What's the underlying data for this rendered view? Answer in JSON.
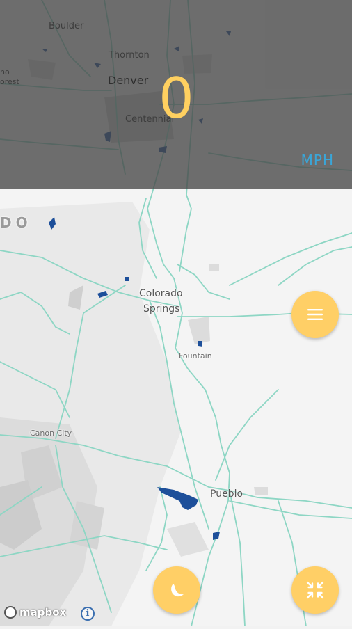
{
  "map": {
    "cities": {
      "boulder": "Boulder",
      "thornton": "Thornton",
      "denver": "Denver",
      "centennial": "Centennial",
      "colorado": "Colorado",
      "springs": "Springs",
      "fountain": "Fountain",
      "canon_city": "Canon City",
      "pueblo": "Pueblo",
      "state_fragment": "DO",
      "left_fragment_1": "no",
      "left_fragment_2": "orest"
    }
  },
  "speedometer": {
    "speed": "0",
    "unit": "MPH"
  },
  "attribution": {
    "brand": "mapbox",
    "info": "i"
  },
  "icons": {
    "menu": "menu-icon",
    "night_mode": "moon-icon",
    "collapse": "collapse-icon",
    "info": "info-icon",
    "logo": "mapbox-logo-icon"
  },
  "colors": {
    "accent": "#ffcf66",
    "speed_text": "#ffd060",
    "unit_text": "#3aa6d8",
    "road": "#7fd1bf",
    "water": "#1d4f9a",
    "overlay": "#4a4a4a"
  }
}
